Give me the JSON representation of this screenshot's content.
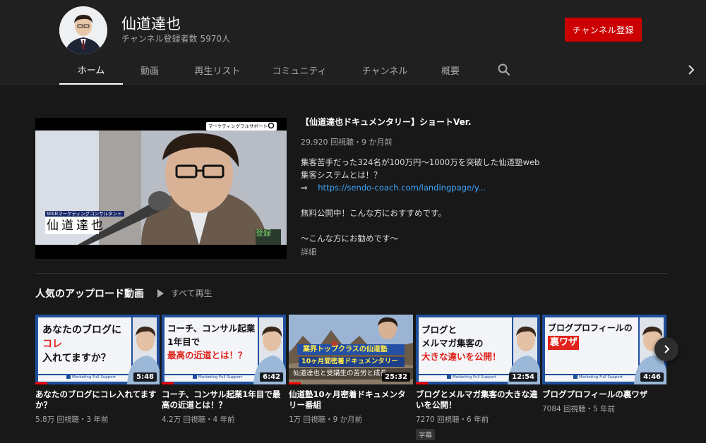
{
  "channel": {
    "name": "仙道達也",
    "subscribers": "チャンネル登録者数 5970人",
    "subscribe_label": "チャンネル登録"
  },
  "tabs": [
    {
      "label": "ホーム",
      "active": true
    },
    {
      "label": "動画"
    },
    {
      "label": "再生リスト"
    },
    {
      "label": "コミュニティ"
    },
    {
      "label": "チャンネル"
    },
    {
      "label": "概要"
    }
  ],
  "icons": {
    "search": "search-icon",
    "tabs_next": "chevron-right-icon",
    "shelf_next": "chevron-right-icon",
    "play_all": "play-icon"
  },
  "featured": {
    "title": "【仙道達也ドキュメンタリー】ショートVer.",
    "meta": "29,920 回視聴・9 か月前",
    "desc_line1": "集客苦手だった324名が100万円〜1000万を突破した仙道塾web",
    "desc_line2": "集客システムとは！？",
    "arrow": "⇒",
    "link": "https://sendo-coach.com/landingpage/y...",
    "desc_line4": "無料公開中！こんな方におすすめです。",
    "desc_line5": "〜こんな方にお勧めです〜",
    "more": "詳細",
    "thumb_search": "マーケティングフルサポート",
    "thumb_role": "WEBマーケティングコンサルタント",
    "thumb_name": "仙道達也",
    "thumb_subscribe": "登録"
  },
  "shelf": {
    "title": "人気のアップロード動画",
    "play_all": "すべて再生",
    "videos": [
      {
        "thumb_lines": [
          "あなたのブログに",
          "コレ",
          "入れてますか？"
        ],
        "thumb_footer": "Marketing Full Support",
        "duration": "5:48",
        "title": "あなたのブログにコレ入れてますか？",
        "meta": "5.8万 回視聴・3 年前",
        "progress": 0.1
      },
      {
        "thumb_lines": [
          "コーチ、コンサル起業",
          "1年目で",
          "最高の近道とは！？"
        ],
        "thumb_footer": "Marketing Full Support",
        "duration": "6:42",
        "title": "コーチ、コンサル起業1年目で最高の近道とは！？",
        "meta": "4.2万 回視聴・4 年前",
        "progress": 0.1
      },
      {
        "thumb_lines": [
          "業界トップクラスの仙道塾",
          "10ヶ月間密着ドキュメンタリー",
          "仙道達也と受講生の苦労と成長"
        ],
        "thumb_footer": "",
        "duration": "25:32",
        "title": "仙道塾10ヶ月密着ドキュメンタリー番組",
        "meta": "1万 回視聴・9 か月前",
        "progress": 0.1
      },
      {
        "thumb_lines": [
          "ブログと",
          "メルマガ集客の",
          "大きな違いを公開！"
        ],
        "thumb_footer": "Marketing Full Support",
        "duration": "12:54",
        "title": "ブログとメルマガ集客の大きな違いを公開！",
        "meta": "7270 回視聴・6 年前",
        "badge": "字幕",
        "progress": 0.1
      },
      {
        "thumb_lines": [
          "ブログプロフィールの",
          "裏ワザ"
        ],
        "thumb_footer": "Marketing Full Support",
        "duration": "4:46",
        "title": "ブログプロフィールの裏ワザ",
        "meta": "7084 回視聴・5 年前",
        "progress": 0
      }
    ]
  },
  "colors": {
    "accent_red": "#cc0000",
    "link_blue": "#3ea6ff",
    "thumb_blue": "#1f4e9c"
  }
}
